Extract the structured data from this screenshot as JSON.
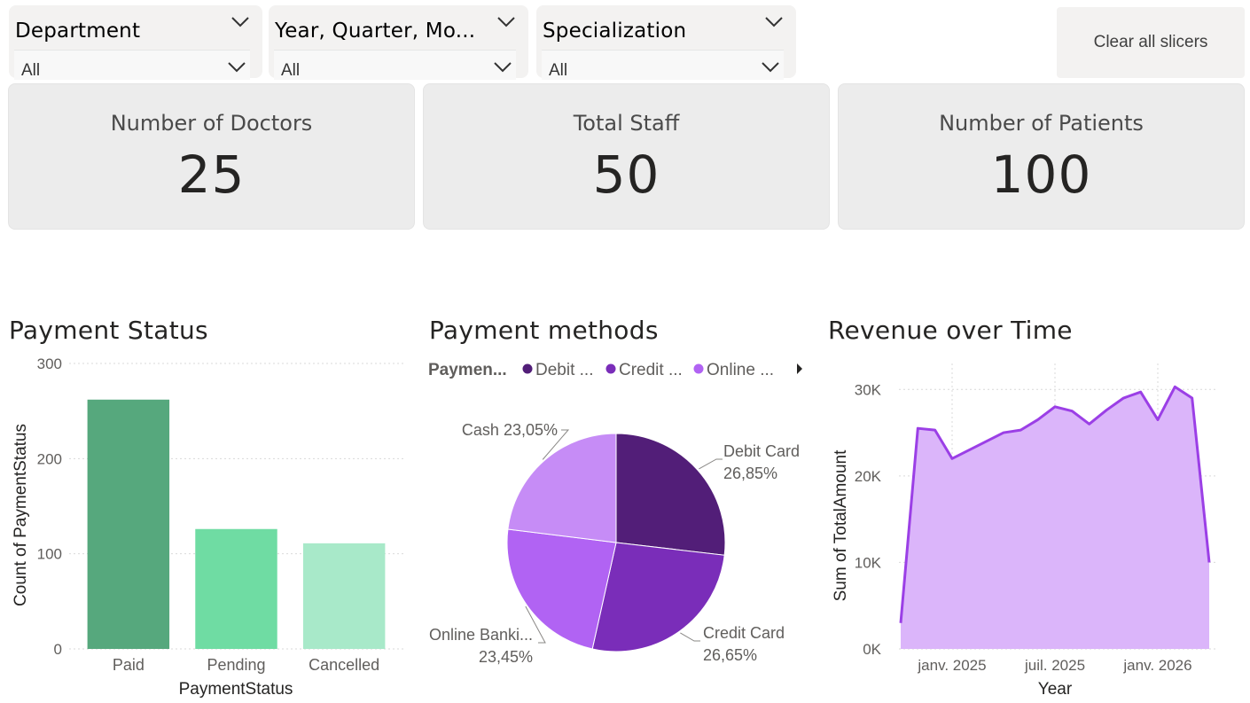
{
  "slicers": [
    {
      "title": "Department",
      "value": "All"
    },
    {
      "title": "Year, Quarter, Mo...",
      "value": "All"
    },
    {
      "title": "Specialization",
      "value": "All"
    }
  ],
  "clear_button": {
    "label": "Clear all slicers"
  },
  "cards": [
    {
      "label": "Number of Doctors",
      "value": "25"
    },
    {
      "label": "Total Staff",
      "value": "50"
    },
    {
      "label": "Number of Patients",
      "value": "100"
    }
  ],
  "chart_data": [
    {
      "type": "bar",
      "title": "Payment Status",
      "xlabel": "PaymentStatus",
      "ylabel": "Count of PaymentStatus",
      "categories": [
        "Paid",
        "Pending",
        "Cancelled"
      ],
      "values": [
        262,
        126,
        111
      ],
      "ylim": [
        0,
        300
      ],
      "yticks": [
        0,
        100,
        200,
        300
      ],
      "colors": [
        "#56a87d",
        "#6fdca3",
        "#a8e9c9"
      ],
      "grid": true
    },
    {
      "type": "pie",
      "title": "Payment methods",
      "legend_title": "Paymen...",
      "legend_entries": [
        "Debit ...",
        "Credit ...",
        "Online ..."
      ],
      "legend_placement": "top",
      "slices": [
        {
          "name": "Debit Card",
          "value": 26.85,
          "label_name": "Debit Card",
          "label_value": "26,85%",
          "color": "#521e78"
        },
        {
          "name": "Credit Card",
          "value": 26.65,
          "label_name": "Credit Card",
          "label_value": "26,65%",
          "color": "#7a2db9"
        },
        {
          "name": "Online Banking",
          "value": 23.45,
          "label_name": "Online Banki...",
          "label_value": "23,45%",
          "color": "#b163f3"
        },
        {
          "name": "Cash",
          "value": 23.05,
          "label_name": "Cash 23,05%",
          "label_value": "",
          "color": "#c68cf6"
        }
      ]
    },
    {
      "type": "area",
      "title": "Revenue over Time",
      "xlabel": "Year",
      "ylabel": "Sum of TotalAmount",
      "x": [
        "2024-10",
        "2024-11",
        "2024-12",
        "2025-01",
        "2025-02",
        "2025-03",
        "2025-04",
        "2025-05",
        "2025-06",
        "2025-07",
        "2025-08",
        "2025-09",
        "2025-10",
        "2025-11",
        "2025-12",
        "2026-01",
        "2026-02",
        "2026-03",
        "2026-04"
      ],
      "values": [
        3000,
        25500,
        25300,
        22000,
        23000,
        24000,
        25000,
        25300,
        26500,
        28000,
        27500,
        26000,
        27600,
        29000,
        29700,
        26500,
        30300,
        29000,
        10000
      ],
      "ylim": [
        0,
        33000
      ],
      "yticks": [
        0,
        10000,
        20000,
        30000
      ],
      "ytick_labels": [
        "0K",
        "10K",
        "20K",
        "30K"
      ],
      "xtick_labels": [
        "janv. 2025",
        "juil. 2025",
        "janv. 2026"
      ],
      "line_color": "#9b3fe6",
      "fill_color": "#dbb5fa",
      "grid": true
    }
  ]
}
